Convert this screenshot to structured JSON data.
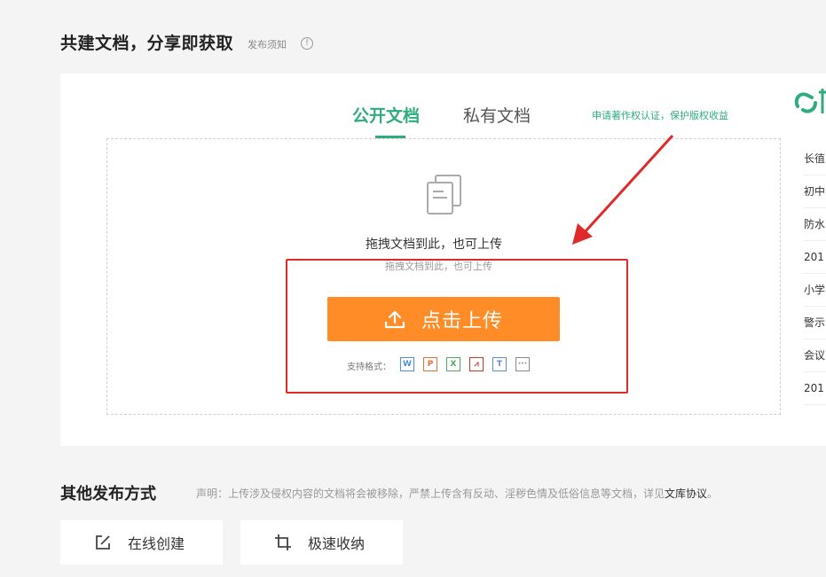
{
  "header": {
    "title": "共建文档，分享即获取",
    "publish_note": "发布须知",
    "info_icon": "info-circle-icon"
  },
  "tabs": [
    {
      "label": "公开文档",
      "active": true
    },
    {
      "label": "私有文档",
      "active": false
    }
  ],
  "copyright_link": "申请著作权认证，保护版权收益",
  "upload": {
    "drag_text": "拖拽文档到此，也可上传",
    "drag_subtext": "拖拽文档到此，也可上传",
    "button_label": "点击上传",
    "formats_label": "支持格式：",
    "formats": [
      {
        "glyph": "W",
        "color": "#4a90d9"
      },
      {
        "glyph": "P",
        "color": "#e3713d"
      },
      {
        "glyph": "X",
        "color": "#4bab5c"
      },
      {
        "glyph": "⩘",
        "color": "#d8322f"
      },
      {
        "glyph": "T",
        "color": "#5b8fc7"
      },
      {
        "glyph": "···",
        "color": "#888888"
      }
    ]
  },
  "side_list": [
    "长徝",
    "初中",
    "防水",
    "201",
    "小学",
    "警示",
    "会议",
    "201"
  ],
  "other_methods": {
    "title": "其他发布方式",
    "statement": "声明：上传涉及侵权内容的文档将会被移除，严禁上传含有反动、淫秽色情及低俗信息等文档，详见",
    "agreement_link": "文库协议",
    "statement_end": "。",
    "buttons": [
      {
        "label": "在线创建",
        "icon": "edit-icon"
      },
      {
        "label": "极速收纳",
        "icon": "crop-icon"
      }
    ]
  },
  "colors": {
    "accent_green": "#2eac7e",
    "upload_orange": "#ff8c26",
    "annotation_red": "#e02a2a"
  }
}
